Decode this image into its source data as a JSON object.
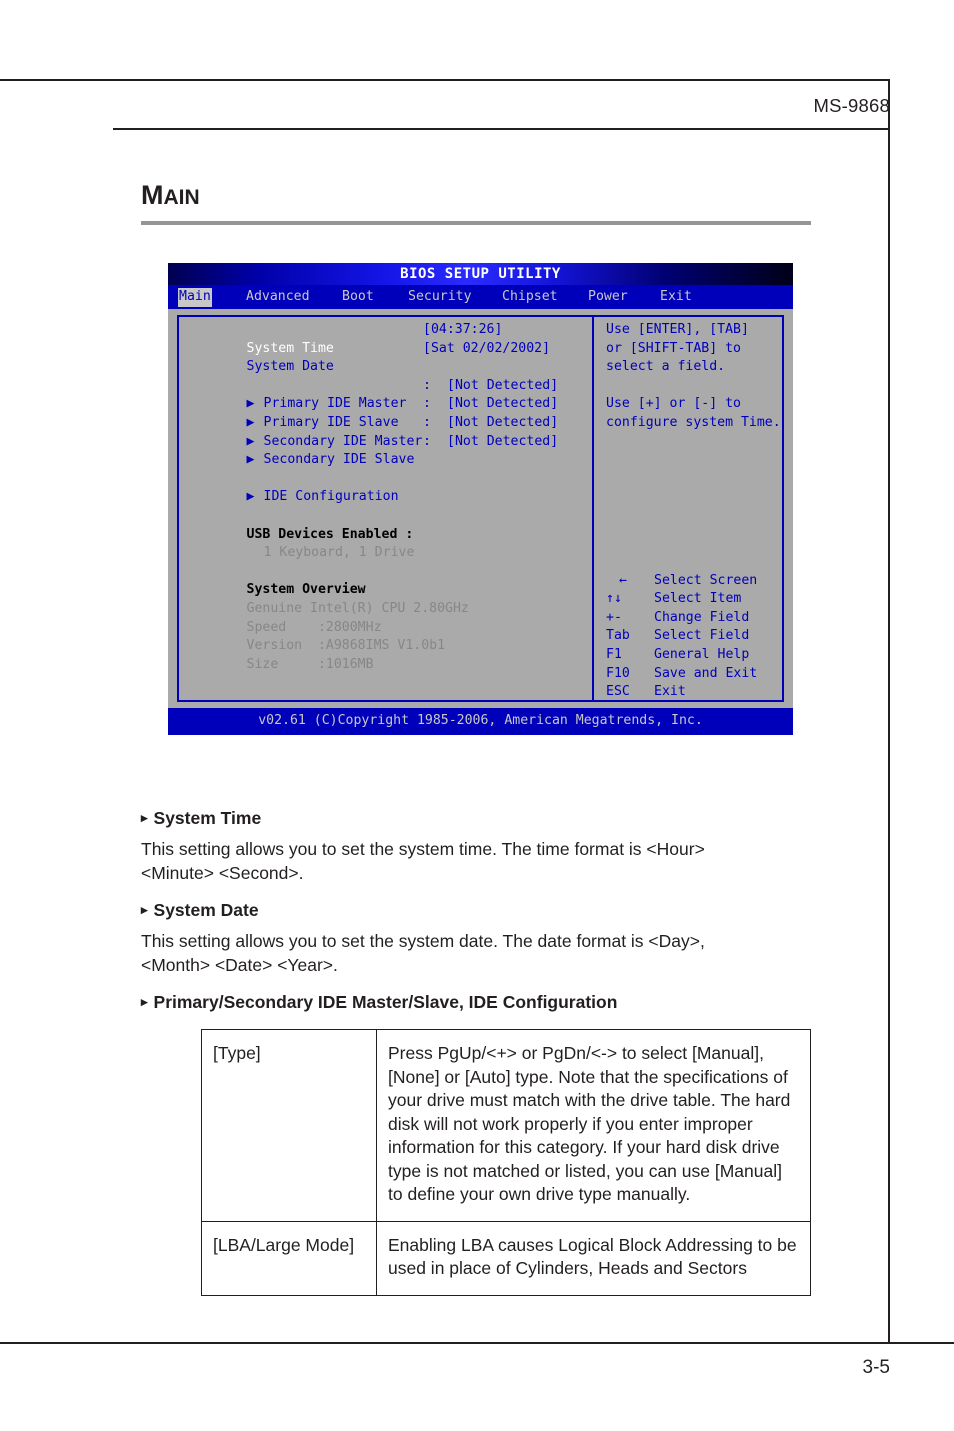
{
  "page": {
    "running_head": "MS-9868",
    "page_number": "3-5",
    "section_title_cap": "M",
    "section_title_rest": "AIN"
  },
  "bios": {
    "title": "BIOS SETUP UTILITY",
    "menu": [
      {
        "label": "Main",
        "active": true
      },
      {
        "label": "Advanced",
        "active": false
      },
      {
        "label": "Boot",
        "active": false
      },
      {
        "label": "Security",
        "active": false
      },
      {
        "label": "Chipset",
        "active": false
      },
      {
        "label": "Power",
        "active": false
      },
      {
        "label": "Exit",
        "active": false
      }
    ],
    "left": {
      "system_time_label": "System Time",
      "system_time_value": "[04:37:26]",
      "system_date_label": "System Date",
      "system_date_value": "[Sat 02/02/2002]",
      "ide_items": [
        {
          "label": "Primary IDE Master",
          "sep": ":",
          "value": "[Not Detected]"
        },
        {
          "label": "Primary IDE Slave",
          "sep": ":",
          "value": "[Not Detected]"
        },
        {
          "label": "Secondary IDE Master",
          "sep": ":",
          "value": "[Not Detected]"
        },
        {
          "label": "Secondary IDE Slave",
          "sep": ":",
          "value": "[Not Detected]"
        }
      ],
      "ide_configuration": "IDE Configuration",
      "usb_heading": "USB Devices Enabled :",
      "usb_detail": "1 Keyboard, 1 Drive",
      "overview_heading": "System Overview",
      "overview_cpu": "Genuine Intel(R) CPU 2.80GHz",
      "overview_speed": "Speed    :2800MHz",
      "overview_version": "Version  :A9868IMS V1.0b1",
      "overview_size": "Size     :1016MB"
    },
    "help": {
      "line1": "Use [ENTER], [TAB]",
      "line2": "or [SHIFT-TAB] to",
      "line3": "select a field.",
      "line4": "Use [+] or [-] to",
      "line5": "configure system Time."
    },
    "keys": [
      {
        "key": "←",
        "desc": "Select Screen"
      },
      {
        "key": "↑↓",
        "desc": "Select Item"
      },
      {
        "key": "+-",
        "desc": "Change Field"
      },
      {
        "key": "Tab",
        "desc": "Select Field"
      },
      {
        "key": "F1",
        "desc": "General Help"
      },
      {
        "key": "F10",
        "desc": "Save and Exit"
      },
      {
        "key": "ESC",
        "desc": "Exit"
      }
    ],
    "footer": "v02.61 (C)Copyright 1985-2006, American Megatrends, Inc.",
    "colors": {
      "panel_bg": "#aaaaaa",
      "blue": "#0000bb",
      "menu_text": "#c8c8c8",
      "gray_text": "#878787"
    }
  },
  "content": {
    "bullets": [
      {
        "marker": "▸",
        "heading": "System Time",
        "body": "This setting allows you to set the system time. The time format is <Hour>",
        "body_last": "<Minute> <Second>."
      },
      {
        "marker": "▸",
        "heading": "System Date",
        "body": "This setting allows you to set the system date. The date format is <Day>,",
        "body_last": "<Month> <Date> <Year>."
      },
      {
        "marker": "▸",
        "heading": "Primary/Secondary IDE Master/Slave, IDE Configuration"
      }
    ],
    "table": {
      "rows": [
        {
          "term": "[Type]",
          "description": "Press PgUp/<+> or PgDn/<-> to select [Manual], [None] or [Auto] type. Note that the specifications of your drive must match with the drive table. The hard disk will not work properly if you enter improper information for this category. If your hard disk drive type is not matched or listed, you can use [Manual] to define your own drive type manually."
        },
        {
          "term": "[LBA/Large Mode]",
          "description": "Enabling LBA causes Logical Block Addressing to be used in place of Cylinders, Heads and Sectors"
        }
      ]
    }
  }
}
